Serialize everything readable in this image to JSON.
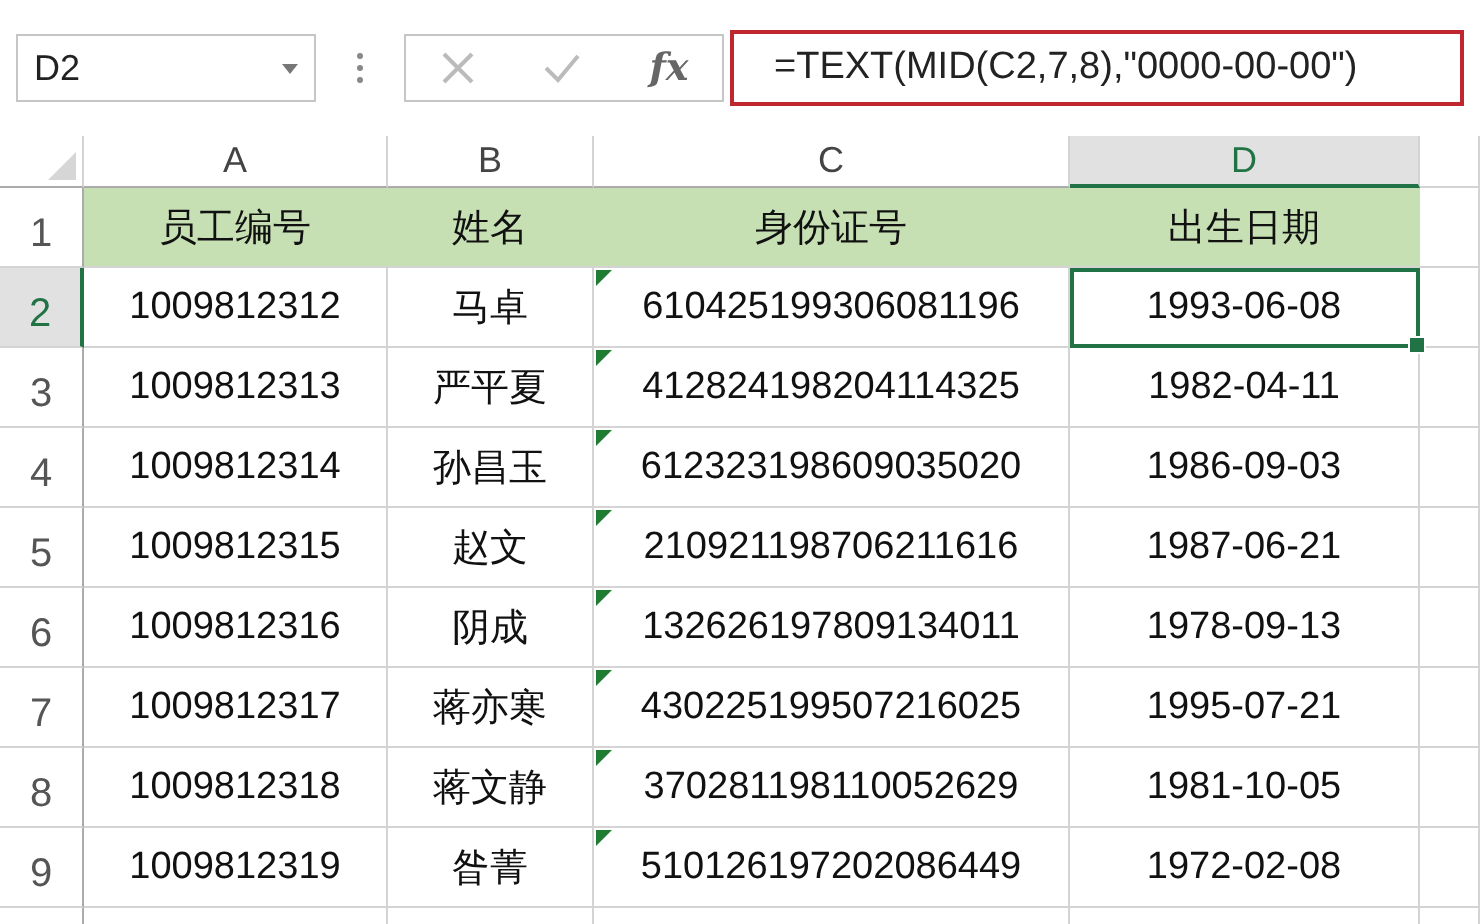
{
  "name_box": {
    "value": "D2"
  },
  "formula_bar": {
    "fx": "fx",
    "formula": "=TEXT(MID(C2,7,8),\"0000-00-00\")"
  },
  "columns": [
    {
      "label": "A",
      "selected": false
    },
    {
      "label": "B",
      "selected": false
    },
    {
      "label": "C",
      "selected": false
    },
    {
      "label": "D",
      "selected": true
    }
  ],
  "rows": [
    {
      "number": "1",
      "selected": false,
      "kind": "header",
      "cells": [
        {
          "text": "员工编号",
          "flag": false,
          "selected": false
        },
        {
          "text": "姓名",
          "flag": false,
          "selected": false
        },
        {
          "text": "身份证号",
          "flag": false,
          "selected": false
        },
        {
          "text": "出生日期",
          "flag": false,
          "selected": false
        }
      ]
    },
    {
      "number": "2",
      "selected": true,
      "kind": "data",
      "cells": [
        {
          "text": "1009812312",
          "flag": false,
          "selected": false
        },
        {
          "text": "马卓",
          "flag": false,
          "selected": false
        },
        {
          "text": "610425199306081196",
          "flag": true,
          "selected": false
        },
        {
          "text": "1993-06-08",
          "flag": false,
          "selected": true
        }
      ]
    },
    {
      "number": "3",
      "selected": false,
      "kind": "data",
      "cells": [
        {
          "text": "1009812313",
          "flag": false,
          "selected": false
        },
        {
          "text": "严平夏",
          "flag": false,
          "selected": false
        },
        {
          "text": "412824198204114325",
          "flag": true,
          "selected": false
        },
        {
          "text": "1982-04-11",
          "flag": false,
          "selected": false
        }
      ]
    },
    {
      "number": "4",
      "selected": false,
      "kind": "data",
      "cells": [
        {
          "text": "1009812314",
          "flag": false,
          "selected": false
        },
        {
          "text": "孙昌玉",
          "flag": false,
          "selected": false
        },
        {
          "text": "612323198609035020",
          "flag": true,
          "selected": false
        },
        {
          "text": "1986-09-03",
          "flag": false,
          "selected": false
        }
      ]
    },
    {
      "number": "5",
      "selected": false,
      "kind": "data",
      "cells": [
        {
          "text": "1009812315",
          "flag": false,
          "selected": false
        },
        {
          "text": "赵文",
          "flag": false,
          "selected": false
        },
        {
          "text": "210921198706211616",
          "flag": true,
          "selected": false
        },
        {
          "text": "1987-06-21",
          "flag": false,
          "selected": false
        }
      ]
    },
    {
      "number": "6",
      "selected": false,
      "kind": "data",
      "cells": [
        {
          "text": "1009812316",
          "flag": false,
          "selected": false
        },
        {
          "text": "阴成",
          "flag": false,
          "selected": false
        },
        {
          "text": "132626197809134011",
          "flag": true,
          "selected": false
        },
        {
          "text": "1978-09-13",
          "flag": false,
          "selected": false
        }
      ]
    },
    {
      "number": "7",
      "selected": false,
      "kind": "data",
      "cells": [
        {
          "text": "1009812317",
          "flag": false,
          "selected": false
        },
        {
          "text": "蒋亦寒",
          "flag": false,
          "selected": false
        },
        {
          "text": "430225199507216025",
          "flag": true,
          "selected": false
        },
        {
          "text": "1995-07-21",
          "flag": false,
          "selected": false
        }
      ]
    },
    {
      "number": "8",
      "selected": false,
      "kind": "data",
      "cells": [
        {
          "text": "1009812318",
          "flag": false,
          "selected": false
        },
        {
          "text": "蒋文静",
          "flag": false,
          "selected": false
        },
        {
          "text": "370281198110052629",
          "flag": true,
          "selected": false
        },
        {
          "text": "1981-10-05",
          "flag": false,
          "selected": false
        }
      ]
    },
    {
      "number": "9",
      "selected": false,
      "kind": "data",
      "cells": [
        {
          "text": "1009812319",
          "flag": false,
          "selected": false
        },
        {
          "text": "昝菁",
          "flag": false,
          "selected": false
        },
        {
          "text": "510126197202086449",
          "flag": true,
          "selected": false
        },
        {
          "text": "1972-02-08",
          "flag": false,
          "selected": false
        }
      ]
    }
  ]
}
